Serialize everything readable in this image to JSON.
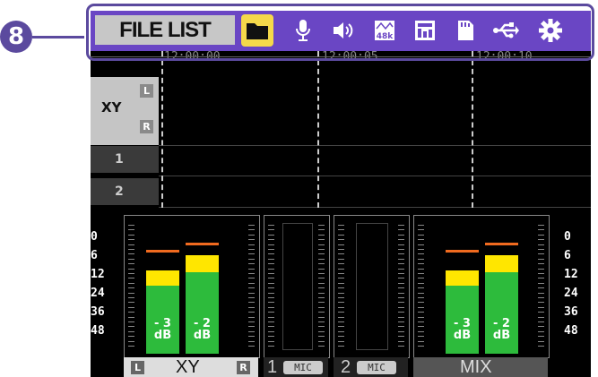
{
  "callout": {
    "number": "8"
  },
  "menu": {
    "file_list_label": "FILE LIST",
    "tabs": [
      {
        "icon": "folder-icon",
        "selected": true
      },
      {
        "icon": "microphone-icon",
        "selected": false
      },
      {
        "icon": "speaker-icon",
        "selected": false
      },
      {
        "icon": "sample-rate-icon",
        "selected": false,
        "text": "48k"
      },
      {
        "icon": "level-meter-icon",
        "selected": false
      },
      {
        "icon": "sd-card-icon",
        "selected": false
      },
      {
        "icon": "usb-icon",
        "selected": false
      },
      {
        "icon": "gear-icon",
        "selected": false
      }
    ]
  },
  "timeline": {
    "ticks": [
      "12:00:00",
      "12:00:05",
      "12:00:10"
    ]
  },
  "tracks": [
    {
      "label": "XY",
      "left": "L",
      "right": "R"
    },
    {
      "label": "1"
    },
    {
      "label": "2"
    }
  ],
  "meters": {
    "scale": [
      "0",
      "6",
      "12",
      "24",
      "36",
      "48"
    ],
    "channels": [
      {
        "name": "XY",
        "left_tag": "L",
        "right_tag": "R",
        "gain_left": "- 3",
        "gain_right": "- 2",
        "unit": "dB",
        "level_left": 0.63,
        "level_right": 0.74
      },
      {
        "name": "1",
        "sub": "MIC"
      },
      {
        "name": "2",
        "sub": "MIC"
      },
      {
        "name": "MIX",
        "gain_left": "- 3",
        "gain_right": "- 2",
        "unit": "dB",
        "level_left": 0.63,
        "level_right": 0.74
      }
    ]
  },
  "colors": {
    "menu_bg": "#6a46c4",
    "selected_tab": "#f5d94a",
    "callout": "#5b4a9e",
    "meter_green": "#2dbb3c",
    "meter_yellow": "#ffe600",
    "peak": "#f06a1f"
  }
}
